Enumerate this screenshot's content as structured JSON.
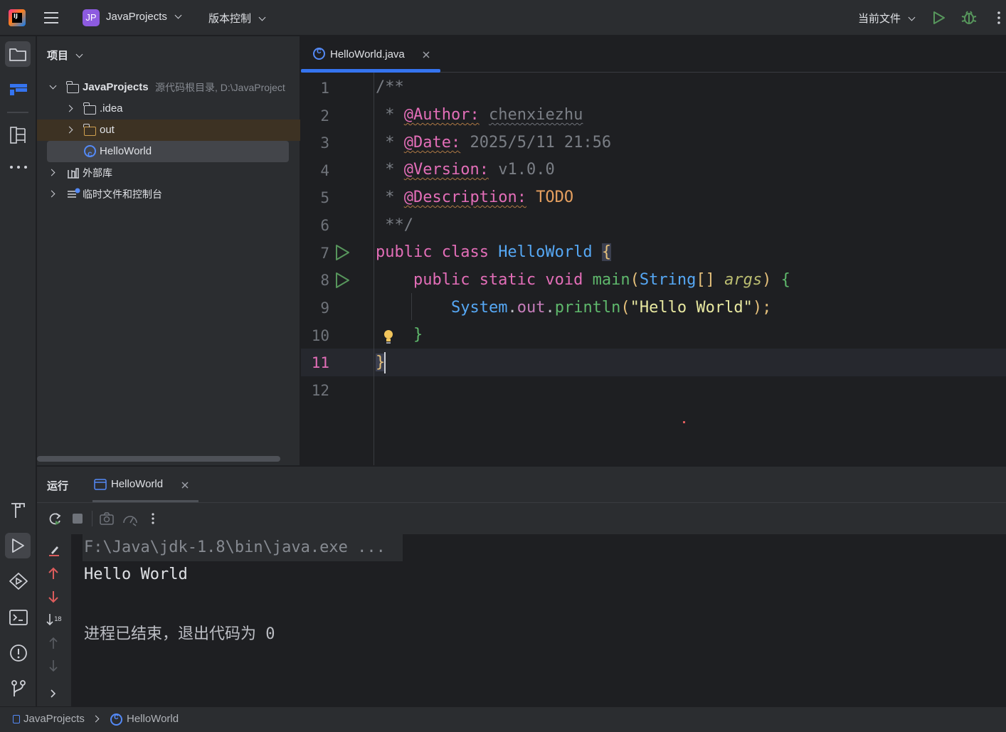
{
  "topbar": {
    "project_badge": "JP",
    "project_name": "JavaProjects",
    "vcs_label": "版本控制",
    "run_config": "当前文件"
  },
  "project_panel": {
    "title": "项目",
    "tree": {
      "root_name": "JavaProjects",
      "root_hint": "源代码根目录, D:\\JavaProject",
      "items": [
        {
          "label": ".idea"
        },
        {
          "label": "out"
        },
        {
          "label": "HelloWorld"
        },
        {
          "label": "外部库"
        },
        {
          "label": "临时文件和控制台"
        }
      ]
    }
  },
  "editor": {
    "tab_label": "HelloWorld.java",
    "line_numbers": [
      "1",
      "2",
      "3",
      "4",
      "5",
      "6",
      "7",
      "8",
      "9",
      "10",
      "11",
      "12"
    ],
    "current_line": "11",
    "code": {
      "l1": "/**",
      "l2_star": " * ",
      "l2_tag": "@Author:",
      "l2_val": "chenxiezhu",
      "l3_star": " * ",
      "l3_tag": "@Date:",
      "l3_val": "2025/5/11 21:56",
      "l4_star": " * ",
      "l4_tag": "@Version:",
      "l4_val": "v1.0.0",
      "l5_star": " * ",
      "l5_tag": "@Description:",
      "l5_val": "TODO",
      "l6": " **/",
      "l7_kw": "public class ",
      "l7_cls": "HelloWorld",
      "l7_brace": "{",
      "l8_kw": "    public static void ",
      "l8_fn": "main",
      "l8_open": "(",
      "l8_type": "String",
      "l8_arr": "[] ",
      "l8_param": "args",
      "l8_close": ") ",
      "l8_brace": "{",
      "l9_indent": "        ",
      "l9_sys": "System",
      "l9_dot1": ".",
      "l9_out": "out",
      "l9_dot2": ".",
      "l9_fn": "println",
      "l9_open": "(",
      "l9_str": "\"Hello World\"",
      "l9_close": ");",
      "l10": "    }",
      "l11": "}"
    }
  },
  "run_panel": {
    "title": "运行",
    "tab_label": "HelloWorld",
    "console": {
      "command": "F:\\Java\\jdk-1.8\\bin\\java.exe ...",
      "output": "Hello World",
      "exit_message": "进程已结束，退出代码为 0"
    }
  },
  "statusbar": {
    "breadcrumb_project": "JavaProjects",
    "breadcrumb_file": "HelloWorld"
  },
  "colors": {
    "accent": "#3574f0",
    "run_green": "#57965c",
    "keyword": "#cf8e6d",
    "doc_tag": "#e36eb8"
  }
}
